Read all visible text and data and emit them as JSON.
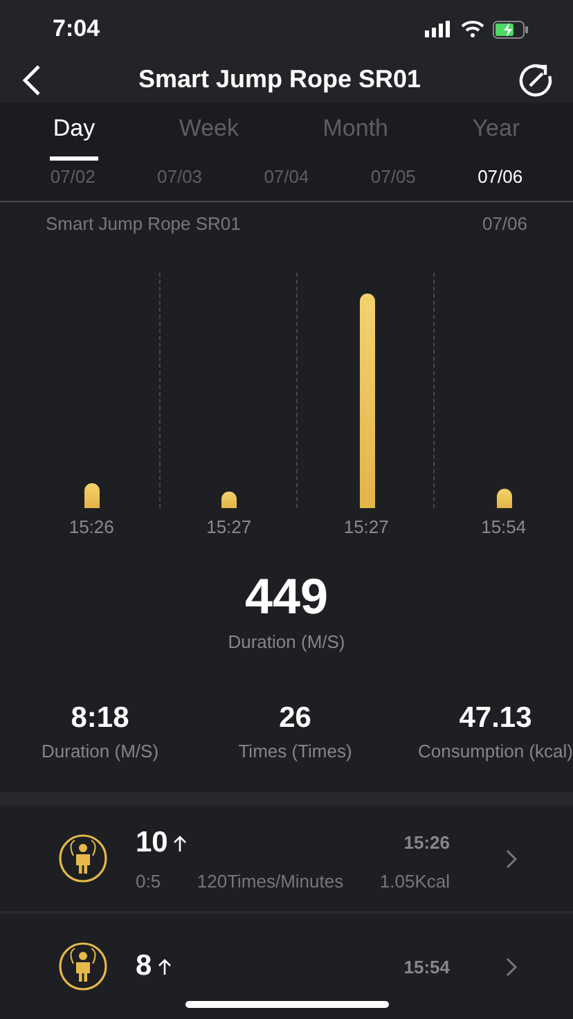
{
  "status_bar": {
    "time": "7:04"
  },
  "nav": {
    "title": "Smart Jump Rope SR01"
  },
  "tabs": [
    {
      "label": "Day",
      "selected": true
    },
    {
      "label": "Week",
      "selected": false
    },
    {
      "label": "Month",
      "selected": false
    },
    {
      "label": "Year",
      "selected": false
    }
  ],
  "dates": [
    {
      "label": "07/02",
      "selected": false
    },
    {
      "label": "07/03",
      "selected": false
    },
    {
      "label": "07/04",
      "selected": false
    },
    {
      "label": "07/05",
      "selected": false
    },
    {
      "label": "07/06",
      "selected": true
    }
  ],
  "chart": {
    "title": "Smart Jump Rope SR01",
    "date": "07/06",
    "bars": [
      {
        "label": "15:26"
      },
      {
        "label": "15:27"
      },
      {
        "label": "15:27"
      },
      {
        "label": "15:54"
      }
    ]
  },
  "summary": {
    "value": "449",
    "label": "Duration (M/S)"
  },
  "stats": [
    {
      "value": "8:18",
      "label": "Duration (M/S)"
    },
    {
      "value": "26",
      "label": "Times (Times)"
    },
    {
      "value": "47.13",
      "label": "Consumption (kcal)"
    }
  ],
  "records": [
    {
      "count": "10",
      "time": "15:26",
      "duration": "0:5",
      "rate": "120Times/Minutes",
      "energy": "1.05Kcal"
    },
    {
      "count": "8",
      "time": "15:54"
    }
  ]
}
